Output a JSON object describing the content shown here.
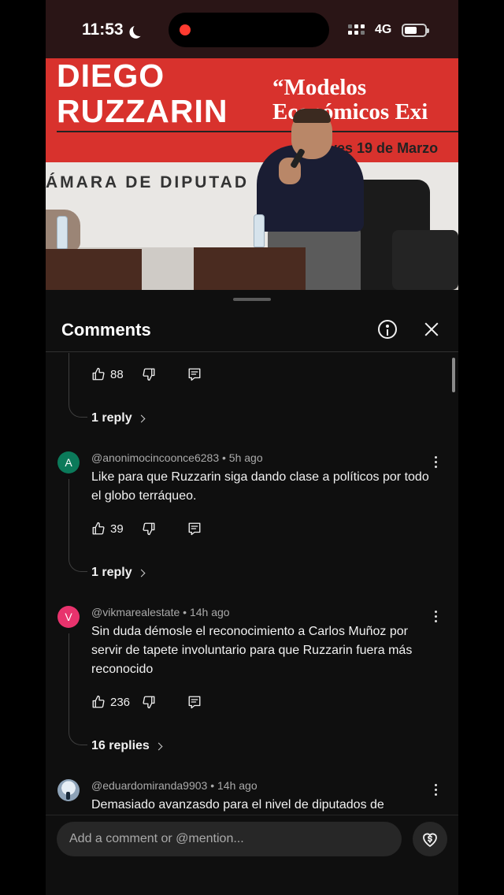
{
  "status": {
    "time": "11:53",
    "network": "4G"
  },
  "video": {
    "speaker_line1": "DIEGO",
    "speaker_line2": "RUZZARIN",
    "topic_line1": "“Modelos",
    "topic_line2": "Económicos Exi",
    "date": "ves 19 de Marzo",
    "venue": "ÁMARA DE DIPUTAD"
  },
  "sheet": {
    "title": "Comments"
  },
  "comments": [
    {
      "likes": "88",
      "replies_label": "1 reply"
    },
    {
      "avatar_letter": "A",
      "avatar_color": "#0b7a5a",
      "author": "@anonimocincoonce6283",
      "time": "5h ago",
      "text": "Like para que Ruzzarin siga dando clase a políticos por todo el globo terráqueo.",
      "likes": "39",
      "replies_label": "1 reply"
    },
    {
      "avatar_letter": "V",
      "avatar_color": "#e8336d",
      "author": "@vikmarealestate",
      "time": "14h ago",
      "text": "Sin duda démosle el reconocimiento a Carlos Muñoz por servir de tapete involuntario para que Ruzzarin fuera más reconocido",
      "likes": "236",
      "replies_label": "16 replies"
    },
    {
      "author": "@eduardomiranda9903",
      "time": "14h ago",
      "text": "Demasiado avanzasdo para el nivel de diputados de"
    }
  ],
  "composer": {
    "placeholder": "Add a comment or @mention..."
  },
  "icons": [
    "moon-icon",
    "signal-icon",
    "battery-icon",
    "info-icon",
    "close-icon",
    "like-icon",
    "dislike-icon",
    "reply-icon",
    "more-icon",
    "chevron-right-icon",
    "thanks-icon"
  ]
}
